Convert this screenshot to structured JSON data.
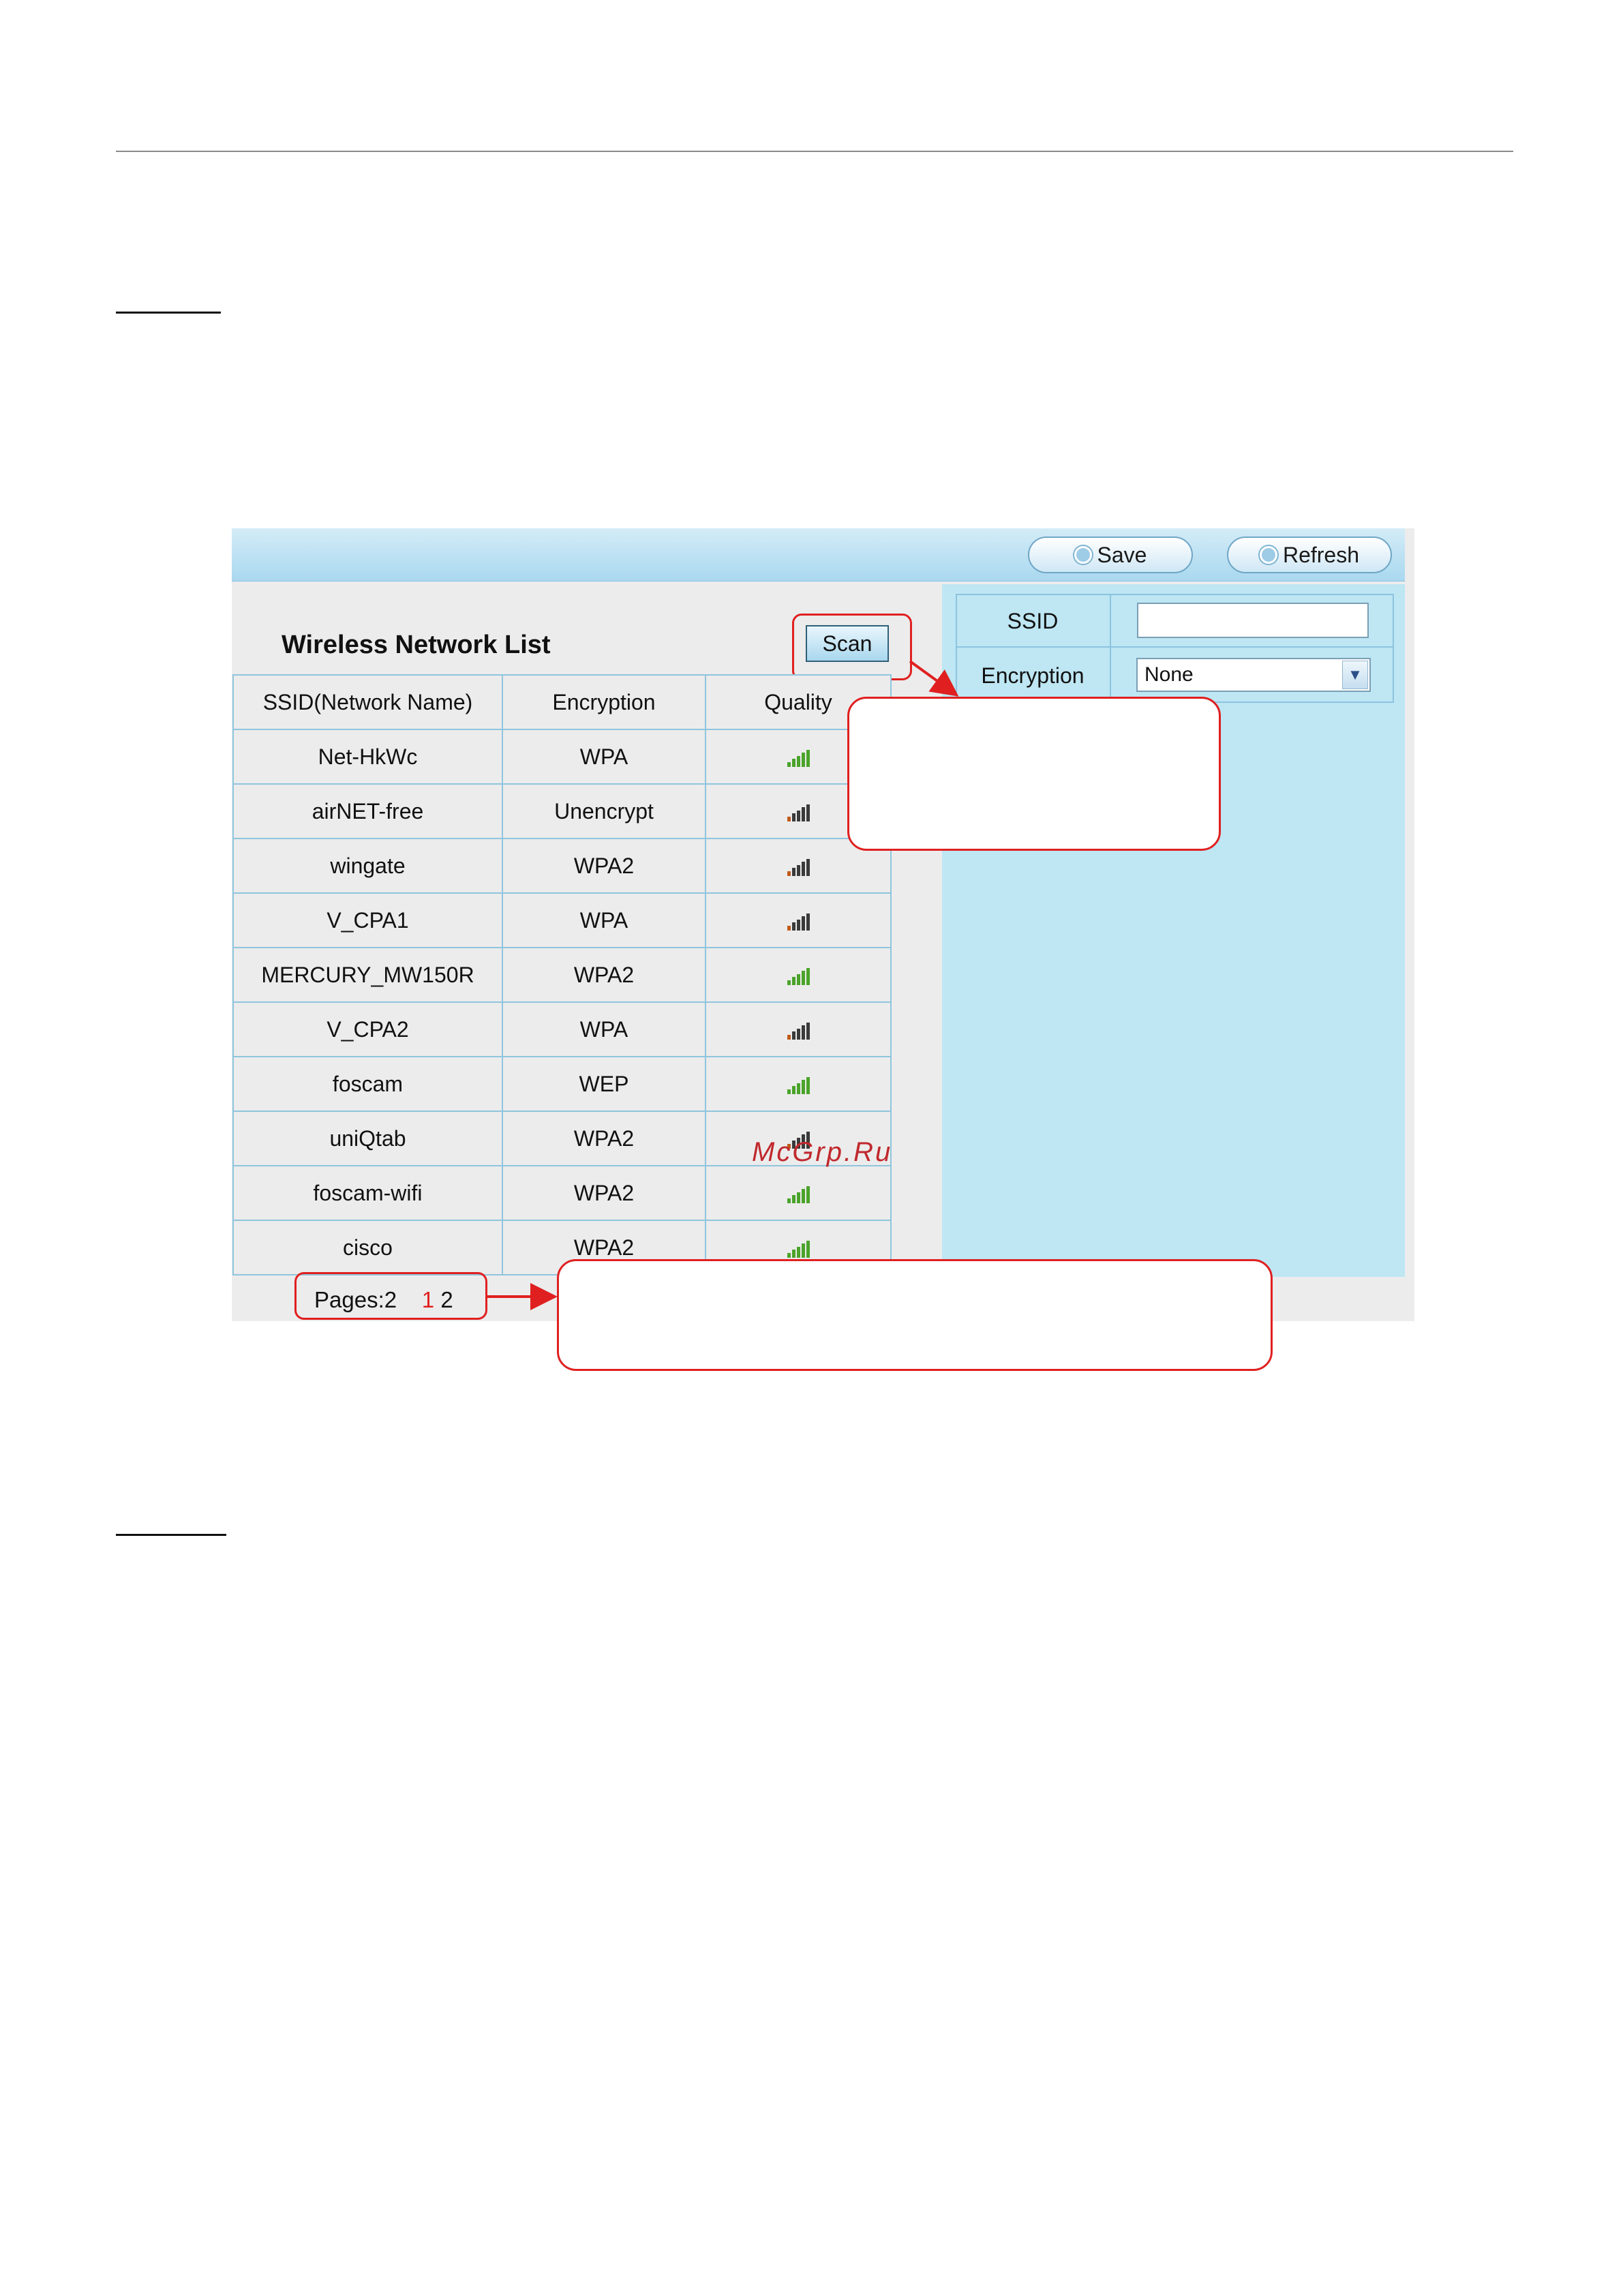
{
  "toolbar": {
    "save_label": "Save",
    "refresh_label": "Refresh"
  },
  "network_list": {
    "title": "Wireless Network List",
    "scan_label": "Scan",
    "columns": [
      "SSID(Network Name)",
      "Encryption",
      "Quality"
    ],
    "rows": [
      {
        "ssid": "Net-HkWc",
        "encryption": "WPA",
        "quality": "good"
      },
      {
        "ssid": "airNET-free",
        "encryption": "Unencrypt",
        "quality": "weak"
      },
      {
        "ssid": "wingate",
        "encryption": "WPA2",
        "quality": "weak"
      },
      {
        "ssid": "V_CPA1",
        "encryption": "WPA",
        "quality": "weak"
      },
      {
        "ssid": "MERCURY_MW150R",
        "encryption": "WPA2",
        "quality": "good"
      },
      {
        "ssid": "V_CPA2",
        "encryption": "WPA",
        "quality": "weak"
      },
      {
        "ssid": "foscam",
        "encryption": "WEP",
        "quality": "good"
      },
      {
        "ssid": "uniQtab",
        "encryption": "WPA2",
        "quality": "weak"
      },
      {
        "ssid": "foscam-wifi",
        "encryption": "WPA2",
        "quality": "good"
      },
      {
        "ssid": "cisco",
        "encryption": "WPA2",
        "quality": "good"
      }
    ],
    "pagination": {
      "label": "Pages:2",
      "current": "1",
      "other": "2"
    }
  },
  "settings_form": {
    "ssid_label": "SSID",
    "ssid_value": "",
    "encryption_label": "Encryption",
    "encryption_value": "None"
  },
  "watermark": "McGrp.Ru",
  "colors": {
    "toolbar": "#a9d8ef",
    "panel": "#bee6f3",
    "annotation_red": "#e02020",
    "signal_good": "#4aa32a"
  }
}
